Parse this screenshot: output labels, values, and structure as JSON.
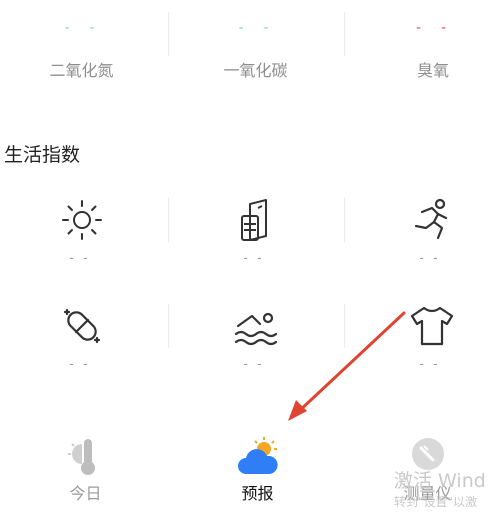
{
  "air_quality": [
    {
      "value": "- -",
      "name": "二氧化氮",
      "value_color": "#7fd6c8"
    },
    {
      "value": "- -",
      "name": "一氧化碳",
      "value_color": "#7fd6c8"
    },
    {
      "value": "- -",
      "name": "臭氧",
      "value_color": "#ee4b4b"
    }
  ],
  "life_index": {
    "title": "生活指数",
    "items": [
      {
        "icon": "sun-icon",
        "value": "--"
      },
      {
        "icon": "car-wash-icon",
        "value": "--"
      },
      {
        "icon": "running-icon",
        "value": "--"
      },
      {
        "icon": "pill-icon",
        "value": "--"
      },
      {
        "icon": "swimming-icon",
        "value": "--"
      },
      {
        "icon": "tshirt-icon",
        "value": "--"
      }
    ]
  },
  "bottom_nav": {
    "items": [
      {
        "label": "今日",
        "icon": "thermometer-icon",
        "active": false
      },
      {
        "label": "预报",
        "icon": "cloud-sun-icon",
        "active": true
      },
      {
        "label": "测量仪",
        "icon": "gauge-icon",
        "active": false
      }
    ]
  },
  "watermark": {
    "line1": "激活 Wind",
    "line2": "转到\"设置\"以激"
  },
  "colors": {
    "arrow": "#e0432f",
    "nav_active": "#111111",
    "nav_inactive": "#9a9a9a",
    "nav_active_icon": "#2f7ef5"
  }
}
